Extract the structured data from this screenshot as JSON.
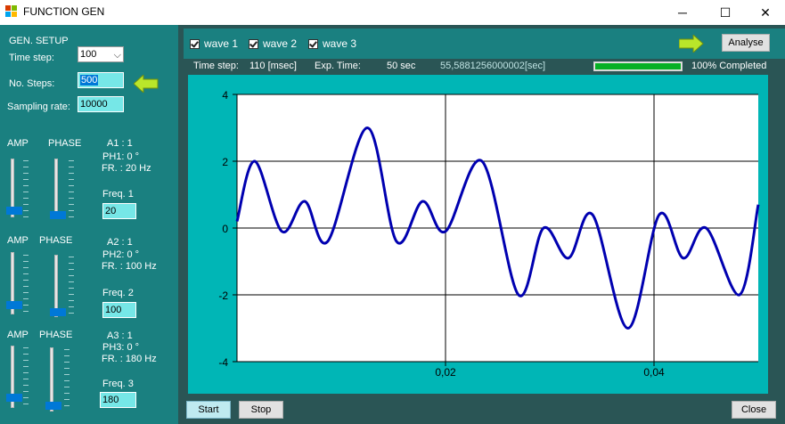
{
  "window": {
    "title": "FUNCTION GEN",
    "minimize": "─",
    "maximize": "☐",
    "close": "✕"
  },
  "setup": {
    "heading": "GEN. SETUP",
    "time_step_label": "Time step:",
    "time_step_value": "100",
    "steps_label": "No. Steps:",
    "steps_value": "500",
    "sampling_label": "Sampling rate:",
    "sampling_value": "10000"
  },
  "waves": [
    {
      "amp_label": "AMP",
      "phase_label": "PHASE",
      "a": "A1 : 1",
      "ph": "PH1: 0 °",
      "fr": "FR. : 20 Hz",
      "freq_label": "Freq. 1",
      "freq_value": "20"
    },
    {
      "amp_label": "AMP",
      "phase_label": "PHASE",
      "a": "A2 : 1",
      "ph": "PH2: 0 °",
      "fr": "FR. : 100 Hz",
      "freq_label": "Freq. 2",
      "freq_value": "100"
    },
    {
      "amp_label": "AMP",
      "phase_label": "PHASE",
      "a": "A3 : 1",
      "ph": "PH3: 0 °",
      "fr": "FR. : 180 Hz",
      "freq_label": "Freq. 3",
      "freq_value": "180"
    }
  ],
  "toolbar": {
    "checkboxes": [
      "wave 1",
      "wave 2",
      "wave 3"
    ],
    "analyse_label": "Analyse"
  },
  "status": {
    "time_step_label": "Time step:",
    "time_step_value": "110 [msec]",
    "exp_time_label": "Exp. Time:",
    "exp_time_value": "50 sec",
    "elapsed": "55,5881256000002[sec]",
    "progress": 1.0,
    "progress_text": "100% Completed"
  },
  "buttons": {
    "start": "Start",
    "stop": "Stop",
    "close": "Close"
  },
  "colors": {
    "panel": "#1a8080",
    "chart_bg": "#00b6b6",
    "line": "#0000b0",
    "progress": "#06b025"
  },
  "chart_data": {
    "type": "line",
    "title": "",
    "xlabel": "",
    "ylabel": "",
    "xlim": [
      0,
      0.05
    ],
    "ylim": [
      -4,
      4
    ],
    "x_ticks": [
      0.02,
      0.04
    ],
    "x_tick_labels": [
      "0,02",
      "0,04"
    ],
    "y_ticks": [
      4,
      2,
      0,
      -2,
      -4
    ],
    "grid": true,
    "series": [
      {
        "components": [
          {
            "amp": 1,
            "freq_hz": 20,
            "phase_deg": 0
          },
          {
            "amp": 1,
            "freq_hz": 100,
            "phase_deg": 0
          },
          {
            "amp": 1,
            "freq_hz": 180,
            "phase_deg": 0
          }
        ],
        "x": [
          0.0,
          0.0017,
          0.0043,
          0.0065,
          0.0087,
          0.0125,
          0.0153,
          0.0178,
          0.02,
          0.0235,
          0.027,
          0.0294,
          0.0318,
          0.0341,
          0.0375,
          0.0405,
          0.0428,
          0.045,
          0.0482,
          0.05
        ],
        "y": [
          0.2,
          2.0,
          -0.1,
          0.8,
          -0.4,
          3.0,
          -0.4,
          0.8,
          -0.1,
          2.0,
          -2.0,
          0.0,
          -0.9,
          0.4,
          -3.0,
          0.4,
          -0.9,
          0.0,
          -2.0,
          0.7
        ]
      }
    ]
  }
}
